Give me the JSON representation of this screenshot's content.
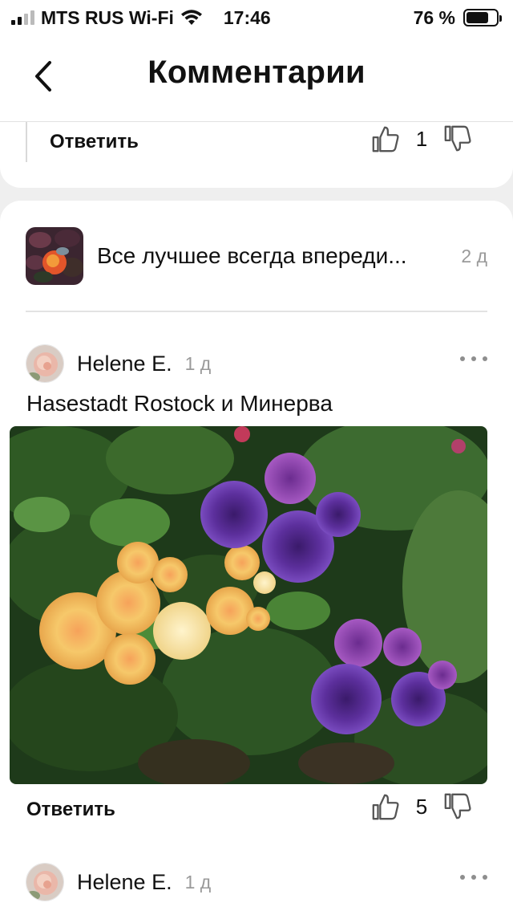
{
  "status_bar": {
    "carrier": "MTS RUS Wi-Fi",
    "time": "17:46",
    "battery": "76 %",
    "battery_level": 0.76
  },
  "nav": {
    "title": "Комментарии",
    "back_icon": "chevron-left-icon"
  },
  "previous_comment": {
    "reply_label": "Ответить",
    "likes": "1"
  },
  "post": {
    "title": "Все лучшее всегда впереди...",
    "age": "2 д"
  },
  "comments": [
    {
      "author": "Helene E.",
      "age": "1 д",
      "text": "Hasestadt Rostock и Минерва",
      "reply_label": "Ответить",
      "likes": "5"
    },
    {
      "author": "Helene E.",
      "age": "1 д"
    }
  ],
  "colors": {
    "background": "#efefef",
    "card": "#ffffff",
    "muted_text": "#9a9a9a"
  }
}
